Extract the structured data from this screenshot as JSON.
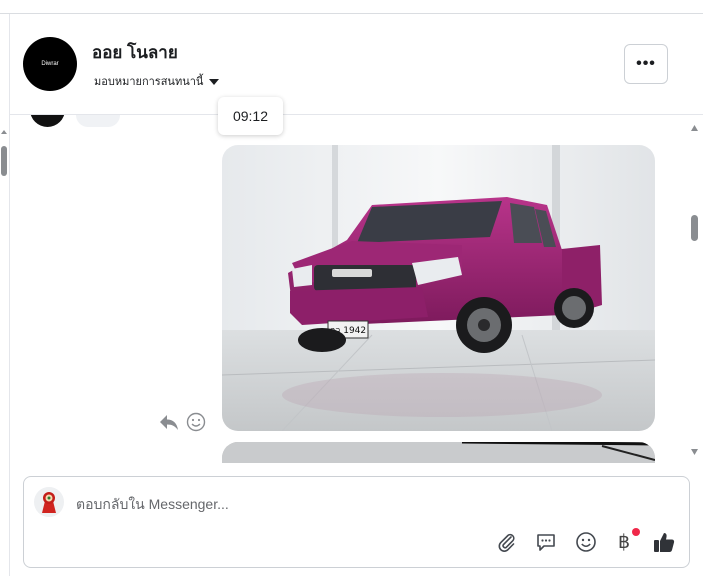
{
  "header": {
    "page_avatar_text": "Diwrar",
    "contact_name": "ออย โนลาย",
    "assign_label": "มอบหมายการสนทนานี้",
    "more_label": "•••"
  },
  "thread": {
    "tooltip_time": "09:12",
    "photo_plate": "กว 1942"
  },
  "composer": {
    "placeholder": "ตอบกลับใน Messenger...",
    "currency_symbol": "฿"
  },
  "colors": {
    "accent": "#1877f2",
    "border": "#ccd0d5",
    "icon_gray": "#65676b",
    "notification": "#f02849",
    "truck": "#a8287a"
  }
}
